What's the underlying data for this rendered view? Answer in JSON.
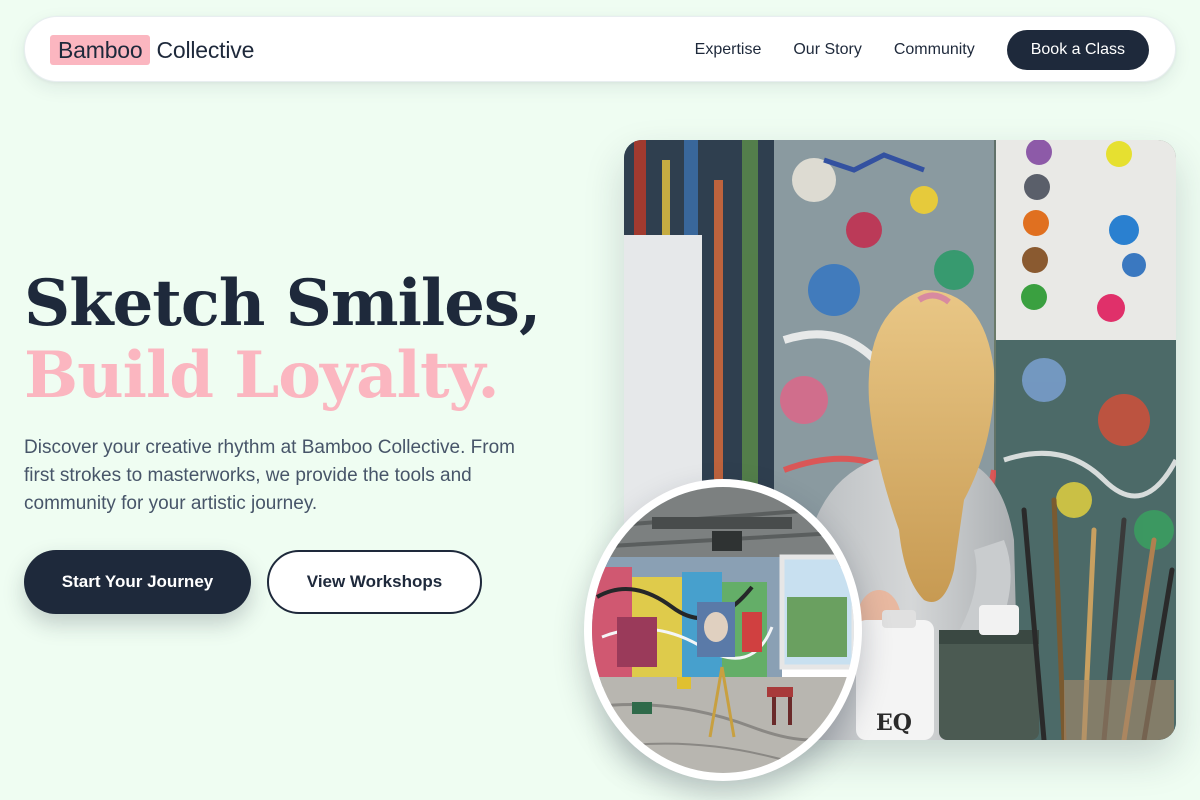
{
  "nav": {
    "brand_highlight": "Bamboo",
    "brand_rest": "Collective",
    "links": [
      "Expertise",
      "Our Story",
      "Community"
    ],
    "cta": "Book a Class"
  },
  "hero": {
    "title_line1": "Sketch Smiles,",
    "title_line2": "Build Loyalty.",
    "subtitle": "Discover your creative rhythm at Bamboo Collective. From first strokes to masterworks, we provide the tools and community for your artistic journey.",
    "primary_button": "Start Your Journey",
    "secondary_button": "View Workshops"
  },
  "images": {
    "main_photo_icon": "child-painting-at-graffiti-wall-photo",
    "studio_photo_icon": "art-studio-interior-photo"
  },
  "colors": {
    "background": "#effdf2",
    "navy": "#1e293b",
    "pink": "#fbb6c0",
    "body_text": "#475569"
  }
}
